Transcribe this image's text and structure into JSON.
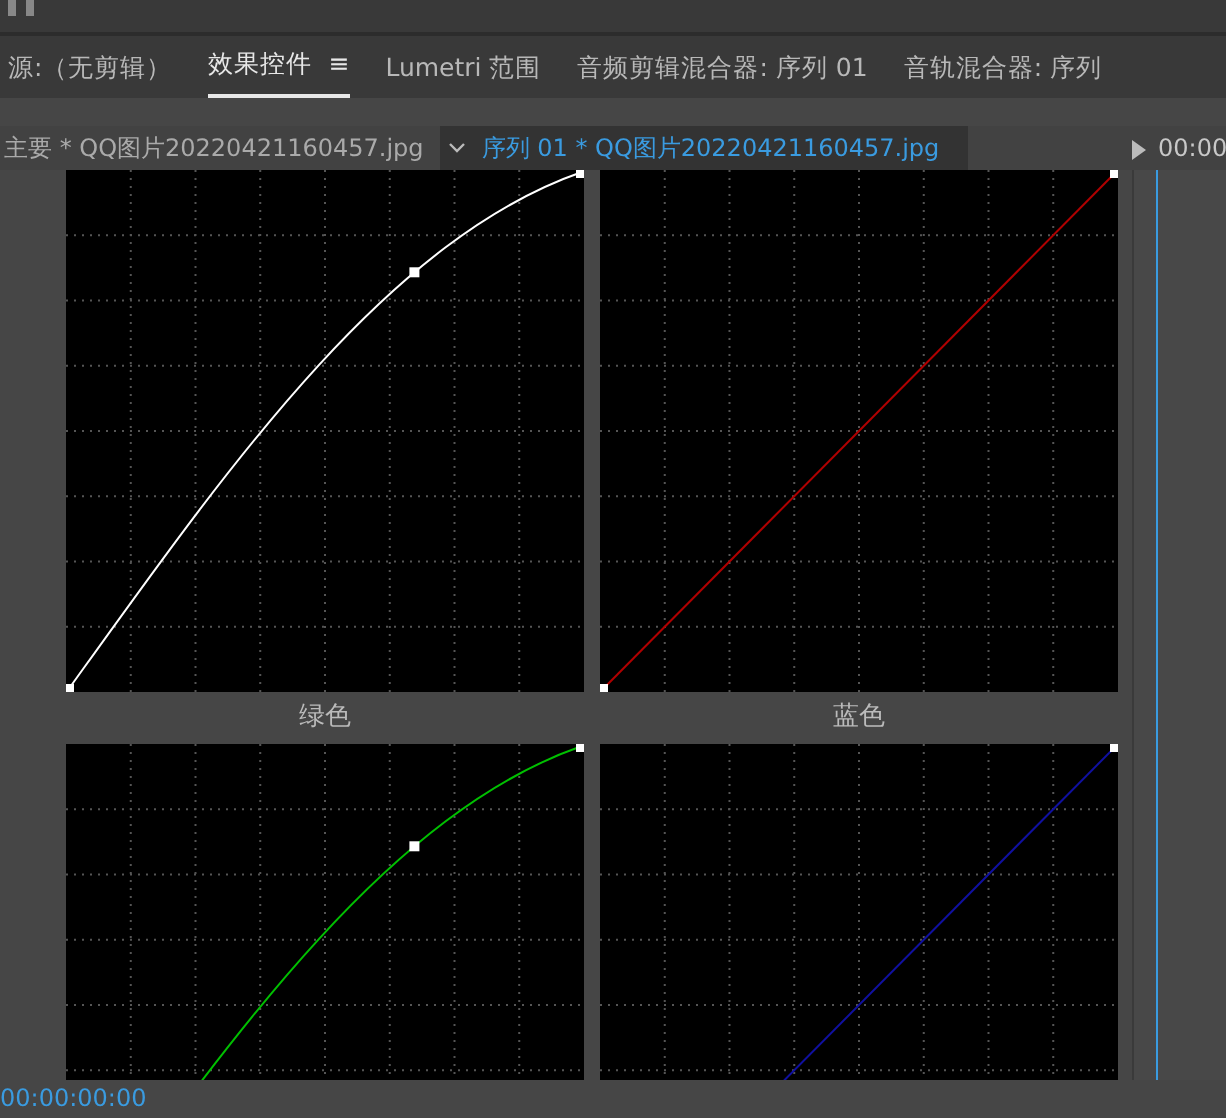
{
  "tabs": [
    {
      "label": "源:（无剪辑）",
      "selected": false
    },
    {
      "label": "效果控件",
      "selected": true,
      "menu": "≡"
    },
    {
      "label": "Lumetri 范围",
      "selected": false
    },
    {
      "label": "音频剪辑混合器: 序列 01",
      "selected": false
    },
    {
      "label": "音轨混合器: 序列",
      "selected": false
    }
  ],
  "clip_bar": {
    "master": "主要 * QQ图片20220421160457.jpg",
    "sequence": "序列 01 * QQ图片20220421160457.jpg",
    "timecode": "00:00"
  },
  "curves": [
    {
      "color": "#ffffff",
      "kind": "bent"
    },
    {
      "color": "#b00000",
      "kind": "linear"
    },
    {
      "label": "绿色",
      "color": "#00c000",
      "kind": "bent"
    },
    {
      "label": "蓝色",
      "color": "#1010a0",
      "kind": "linear"
    }
  ],
  "status_bar": {
    "timecode": "00:00:00:00"
  }
}
